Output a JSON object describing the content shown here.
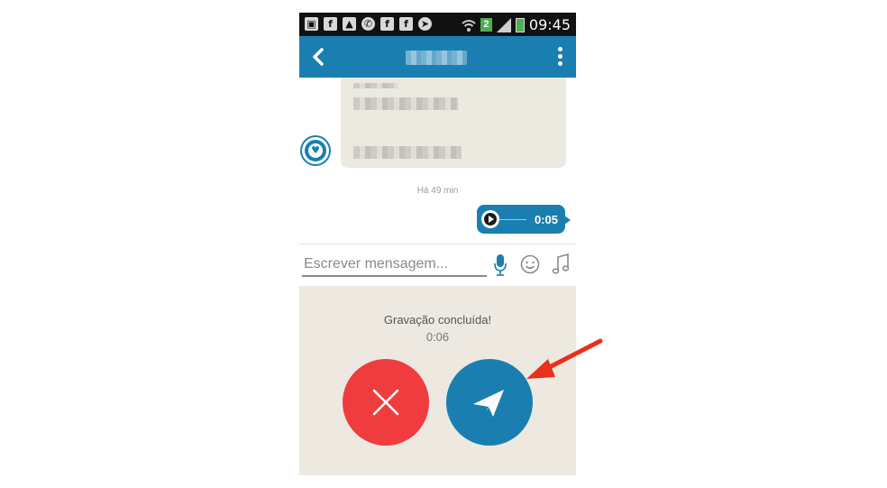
{
  "status_bar": {
    "left_icons": [
      "voicemail-icon",
      "facebook-icon",
      "gallery-icon",
      "whatsapp-icon",
      "facebook-icon",
      "facebook-icon",
      "telegram-icon"
    ],
    "notification_count": "2",
    "time": "09:45"
  },
  "header": {
    "back_icon": "chevron-left-icon",
    "menu_icon": "overflow-menu-icon"
  },
  "chat": {
    "timestamp": "Há 49 min",
    "voice_message": {
      "duration": "0:05"
    }
  },
  "composer": {
    "placeholder": "Escrever mensagem...",
    "icons": [
      "microphone-icon",
      "emoji-icon",
      "music-note-icon"
    ]
  },
  "recording": {
    "status": "Gravação concluída!",
    "duration": "0:06",
    "cancel_icon": "close-icon",
    "send_icon": "paper-plane-icon"
  },
  "colors": {
    "primary": "#1a7fb0",
    "cancel": "#ef3d3f",
    "panel_bg": "#ede9e0",
    "annotation": "#e8301c"
  }
}
